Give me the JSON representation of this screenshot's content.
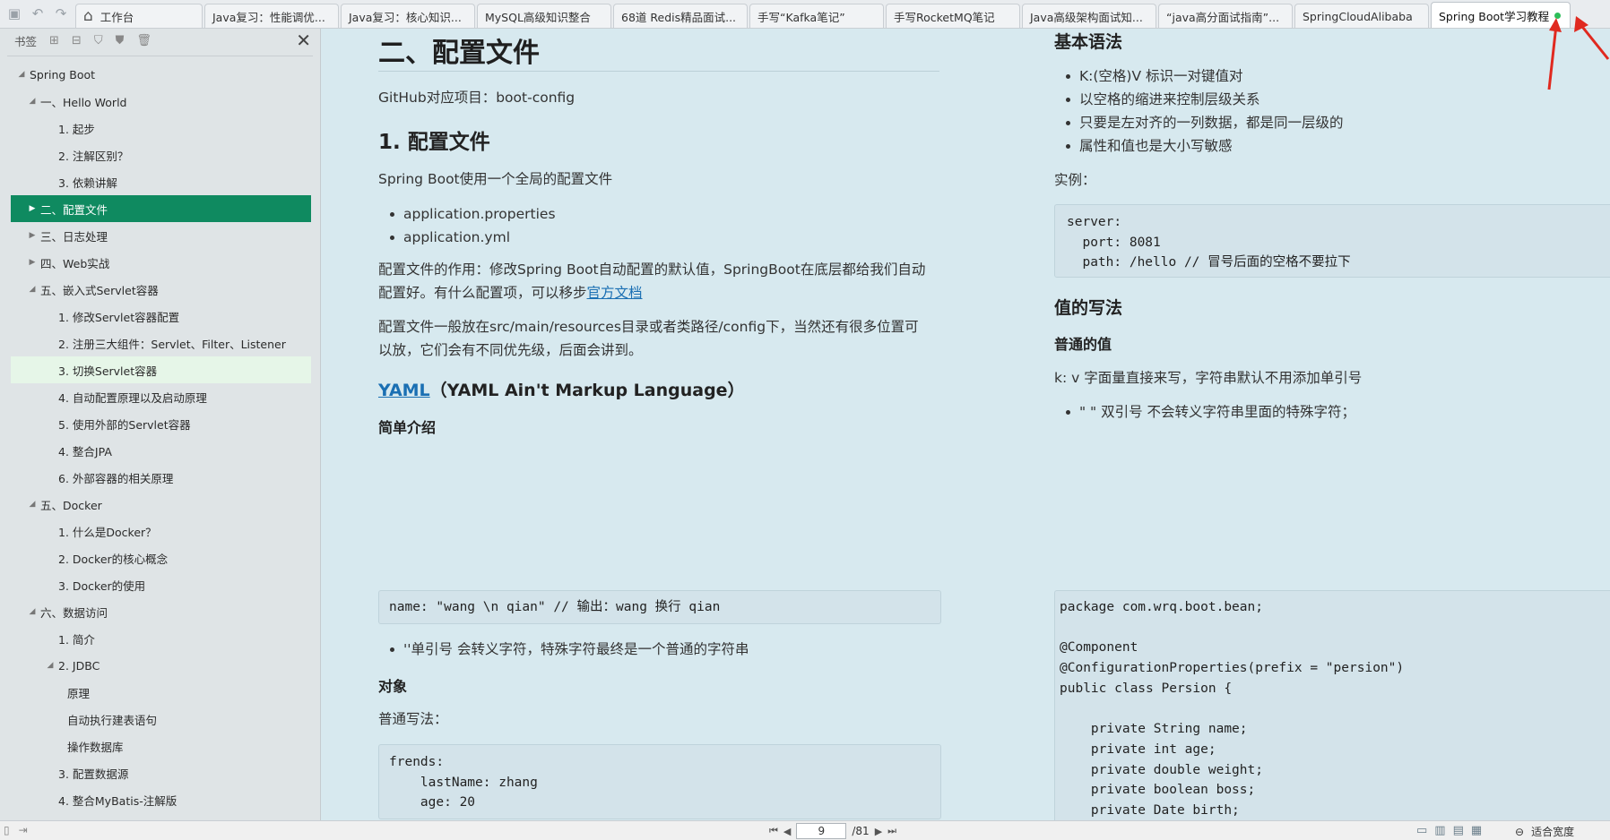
{
  "tabs": [
    {
      "label": "工作台",
      "icon": "home-icon"
    },
    {
      "label": "Java复习：性能调优..."
    },
    {
      "label": "Java复习：核心知识..."
    },
    {
      "label": "MySQL高级知识整合"
    },
    {
      "label": "68道 Redis精品面试..."
    },
    {
      "label": "手写“Kafka笔记”"
    },
    {
      "label": "手写RocketMQ笔记"
    },
    {
      "label": "Java高级架构面试知..."
    },
    {
      "label": "“java高分面试指南”..."
    },
    {
      "label": "SpringCloudAlibaba"
    },
    {
      "label": "Spring Boot学习教程",
      "active": true
    }
  ],
  "sidebar": {
    "title": "书签",
    "tree": [
      {
        "label": "Spring Boot",
        "level": 0,
        "arrow": "▲"
      },
      {
        "label": "一、Hello World",
        "level": 1,
        "arrow": "▲"
      },
      {
        "label": "1. 起步",
        "level": 2,
        "arrow": ""
      },
      {
        "label": "2. 注解区别？",
        "level": 2,
        "arrow": ""
      },
      {
        "label": "3. 依赖讲解",
        "level": 2,
        "arrow": ""
      },
      {
        "label": "二、配置文件",
        "level": 1,
        "arrow": "▶",
        "selected": true
      },
      {
        "label": "三、日志处理",
        "level": 1,
        "arrow": "▶"
      },
      {
        "label": "四、Web实战",
        "level": 1,
        "arrow": "▶"
      },
      {
        "label": "五、嵌入式Servlet容器",
        "level": 1,
        "arrow": "▲"
      },
      {
        "label": "1. 修改Servlet容器配置",
        "level": 2,
        "arrow": ""
      },
      {
        "label": "2. 注册三大组件：Servlet、Filter、Listener",
        "level": 2,
        "arrow": ""
      },
      {
        "label": "3. 切换Servlet容器",
        "level": 2,
        "arrow": "",
        "hover": true
      },
      {
        "label": "4. 自动配置原理以及启动原理",
        "level": 2,
        "arrow": ""
      },
      {
        "label": "5. 使用外部的Servlet容器",
        "level": 2,
        "arrow": ""
      },
      {
        "label": "4. 整合JPA",
        "level": 2,
        "arrow": ""
      },
      {
        "label": "6. 外部容器的相关原理",
        "level": 2,
        "arrow": ""
      },
      {
        "label": "五、Docker",
        "level": 1,
        "arrow": "▲"
      },
      {
        "label": "1. 什么是Docker？",
        "level": 2,
        "arrow": ""
      },
      {
        "label": "2. Docker的核心概念",
        "level": 2,
        "arrow": ""
      },
      {
        "label": "3. Docker的使用",
        "level": 2,
        "arrow": ""
      },
      {
        "label": "六、数据访问",
        "level": 1,
        "arrow": "▲"
      },
      {
        "label": "1. 简介",
        "level": 2,
        "arrow": ""
      },
      {
        "label": "2. JDBC",
        "level": 2,
        "arrow": "▲"
      },
      {
        "label": "原理",
        "level": 3,
        "arrow": ""
      },
      {
        "label": "自动执行建表语句",
        "level": 3,
        "arrow": ""
      },
      {
        "label": "操作数据库",
        "level": 3,
        "arrow": ""
      },
      {
        "label": "3. 配置数据源",
        "level": 2,
        "arrow": ""
      },
      {
        "label": "4. 整合MyBatis-注解版",
        "level": 2,
        "arrow": ""
      }
    ]
  },
  "left_page": {
    "h1": "二、配置文件",
    "github": "GitHub对应项目：boot-config",
    "h2": "1. 配置文件",
    "intro": "Spring Boot使用一个全局的配置文件",
    "files": [
      "application.properties",
      "application.yml"
    ],
    "purpose_line1": "配置文件的作用：修改Spring Boot自动配置的默认值，SpringBoot在底层都给我们自动",
    "purpose_line2_prefix": "配置好。有什么配置项，可以移步",
    "purpose_link": "官方文档",
    "location_line1": "配置文件一般放在src/main/resources目录或者类路径/config下，当然还有很多位置可",
    "location_line2": "以放，它们会有不同优先级，后面会讲到。",
    "yaml_link": "YAML",
    "yaml_title": "（YAML Ain't Markup Language）",
    "yaml_intro": "简单介绍",
    "code_name": "name: \"wang \\n qian\" // 输出：wang 换行 qian",
    "single_quote_note": "''单引号 会转义字符，特殊字符最终是一个普通的字符串",
    "object_title": "对象",
    "normal_style": "普通写法：",
    "code_frends": "frends:\n    lastName: zhang\n    age: 20"
  },
  "right_page": {
    "basic_syntax": "基本语法",
    "syntax_items": [
      "K:(空格)V 标识一对键值对",
      "以空格的缩进来控制层级关系",
      "只要是左对齐的一列数据，都是同一层级的",
      "属性和值也是大小写敏感"
    ],
    "example": "实例：",
    "code_server": "server:\n  port: 8081\n  path: /hello // 冒号后面的空格不要拉下",
    "value_title": "值的写法",
    "normal_value": "普通的值",
    "kv_text": "k: v 字面量直接来写，字符串默认不用添加单引号",
    "double_quote_note": "\" \" 双引号 不会转义字符串里面的特殊字符；",
    "code_java": "package com.wrq.boot.bean;\n\n@Component\n@ConfigurationProperties(prefix = \"persion\")\npublic class Persion {\n\n    private String name;\n    private int age;\n    private double weight;\n    private boolean boss;\n    private Date birth;"
  },
  "bottom": {
    "page": "9",
    "total": "/81",
    "zoom": "适合宽度"
  },
  "colors": {
    "selected": "#0f8a60",
    "annotation_arrow": "#e0291f",
    "page_bg": "#d7e9ef"
  }
}
